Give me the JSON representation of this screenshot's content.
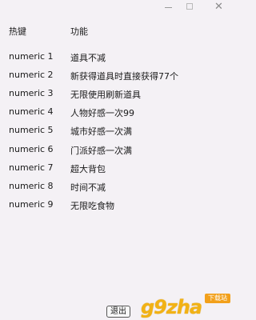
{
  "header": {
    "hotkey": "热键",
    "function": "功能"
  },
  "rows": [
    {
      "key": "numeric 1",
      "func": "道具不减"
    },
    {
      "key": "numeric 2",
      "func": "新获得道具时直接获得77个"
    },
    {
      "key": "numeric 3",
      "func": "无限使用刷新道具"
    },
    {
      "key": "numeric 4",
      "func": "人物好感一次99"
    },
    {
      "key": "numeric 5",
      "func": "城市好感一次满"
    },
    {
      "key": "numeric 6",
      "func": "门派好感一次满"
    },
    {
      "key": "numeric 7",
      "func": "超大背包"
    },
    {
      "key": "numeric 8",
      "func": "时间不减"
    },
    {
      "key": "numeric 9",
      "func": "无限吃食物"
    }
  ],
  "exit_label": "退出",
  "watermark": {
    "logo": "g9zha",
    "tag": "下载站"
  },
  "window_controls": {
    "min": "minimize-icon",
    "max": "maximize-icon",
    "close": "close-icon"
  }
}
